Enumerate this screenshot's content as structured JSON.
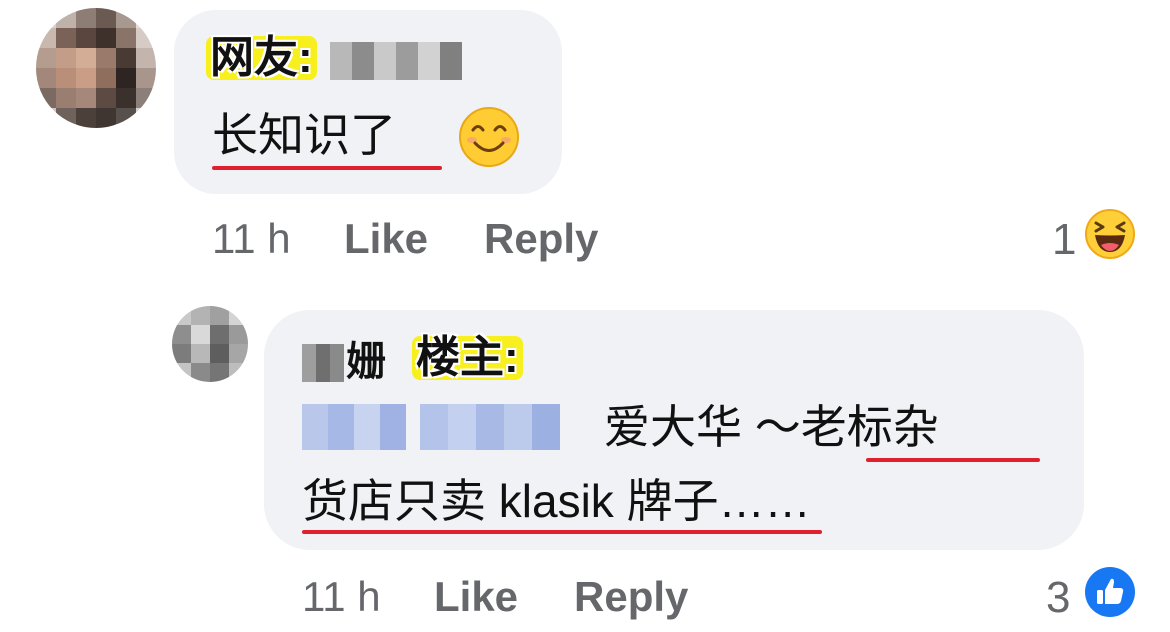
{
  "comments": [
    {
      "label": "网友:",
      "text": "长知识了",
      "emoji": "smiling-face-emoji",
      "time": "11 h",
      "like": "Like",
      "reply": "Reply",
      "reaction_count": "1",
      "reaction_icon": "haha-reaction-icon"
    },
    {
      "name_visible": "姗",
      "label": "楼主:",
      "text_line1": "爱大华 ～老标杂",
      "text_line2": "货店只卖 klasik 牌子……",
      "time": "11 h",
      "like": "Like",
      "reply": "Reply",
      "reaction_count": "3",
      "reaction_icon": "like-reaction-icon"
    }
  ],
  "colors": {
    "bubble": "#f0f2f5",
    "meta_text": "#65676b",
    "highlight": "#f7ef1e",
    "underline": "#e0202e",
    "like_blue": "#1877f2"
  }
}
